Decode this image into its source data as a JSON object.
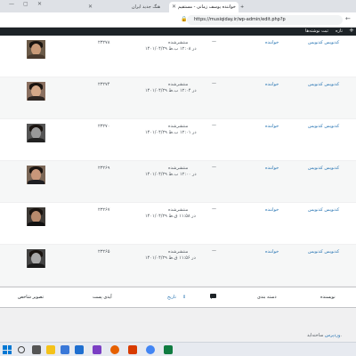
{
  "browser": {
    "tab_active": "هنگ جدید ایران",
    "tab_second": "خواننده یوسف زمانی - مستقیم",
    "tab_close": "✕",
    "new_tab": "+",
    "url": "https://musiqiday.ir/wp-admin/edit.php?p"
  },
  "adminbar": {
    "add_label": "+",
    "new_label": "تازه",
    "edit_posts_label": "ثبت نوشته‌ها"
  },
  "rows": [
    {
      "author": "کدنویس کدنویس",
      "category": "خواننده",
      "dash": "—",
      "status": "منتشرشده",
      "date": "۱۴۰۱/۰۴/۲۹ در ۱۲:۰۸ ب.ظ",
      "id": "۲۳۲۷۸"
    },
    {
      "author": "کدنویس کدنویس",
      "category": "خواننده",
      "dash": "—",
      "status": "منتشرشده",
      "date": "۱۴۰۱/۰۴/۲۹ در ۱۲:۰۴ ب.ظ",
      "id": "۲۳۲۷۴"
    },
    {
      "author": "کدنویس کدنویس",
      "category": "خواننده",
      "dash": "—",
      "status": "منتشرشده",
      "date": "۱۴۰۱/۰۴/۲۹ در ۱۲:۰۱ ب.ظ",
      "id": "۲۳۲۷۰"
    },
    {
      "author": "کدنویس کدنویس",
      "category": "خواننده",
      "dash": "—",
      "status": "منتشرشده",
      "date": "۱۴۰۱/۰۴/۲۹ در ۱۲:۰۰ ب.ظ",
      "id": "۲۳۲۶۹"
    },
    {
      "author": "کدنویس کدنویس",
      "category": "خواننده",
      "dash": "—",
      "status": "منتشرشده",
      "date": "۱۴۰۱/۰۴/۲۹ در ۱۱:۵۸ ق.ظ",
      "id": "۲۳۲۶۷"
    },
    {
      "author": "کدنویس کدنویس",
      "category": "خواننده",
      "dash": "—",
      "status": "منتشرشده",
      "date": "۱۴۰۱/۰۴/۲۹ در ۱۱:۵۶ ق.ظ",
      "id": "۲۳۲۶۵"
    }
  ],
  "footer": {
    "author": "نویسنده",
    "categories": "دسته بندی",
    "date": "تاریخ",
    "sort_arrow": "⇕",
    "post_id": "آیدی پست",
    "featured_image": "تصویر شاخص"
  },
  "credit": {
    "link": "وردپرس",
    "text": "ساخته‌اید."
  },
  "colors": {
    "link": "#2271b1",
    "adminbar": "#1d2327"
  }
}
